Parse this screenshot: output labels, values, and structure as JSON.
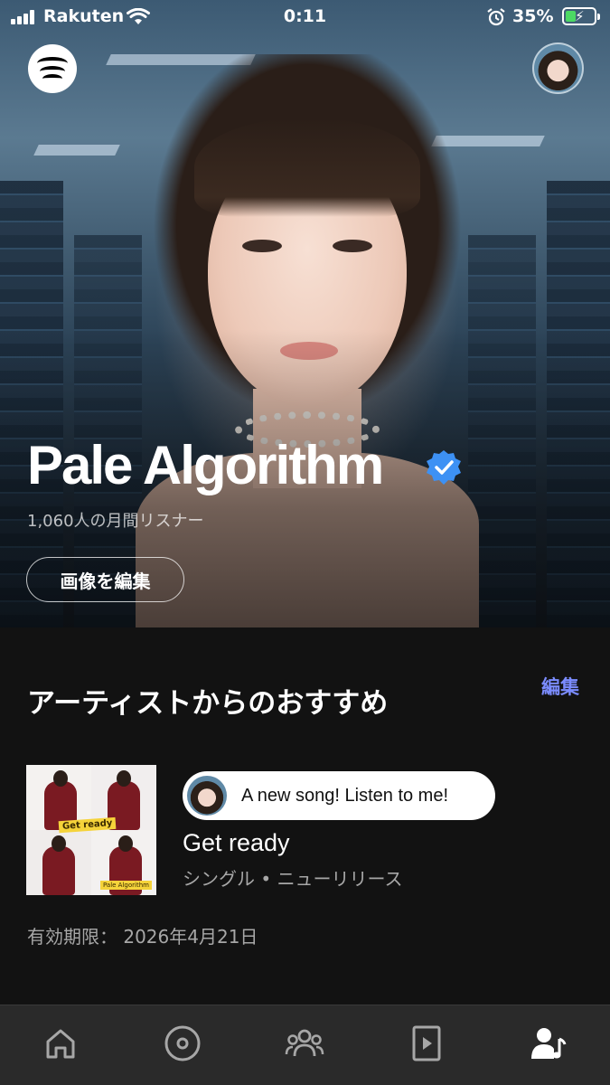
{
  "status_bar": {
    "carrier": "Rakuten",
    "time": "0:11",
    "battery": "35%"
  },
  "artist": {
    "name": "Pale Algorithm",
    "monthly_listeners": "1,060人の月間リスナー",
    "edit_image_label": "画像を編集"
  },
  "recommendation": {
    "section_title": "アーティストからのおすすめ",
    "edit_label": "編集",
    "message": "A new song! Listen to me!",
    "release_title": "Get ready",
    "release_subtitle": "シングル • ニューリリース",
    "expiry": "有効期限： 2026年4月21日",
    "cover_text": "Get ready",
    "cover_subtext": "Pale Algorithm"
  },
  "tabbar": {
    "items": [
      {
        "icon": "home-icon"
      },
      {
        "icon": "disc-icon"
      },
      {
        "icon": "audience-icon"
      },
      {
        "icon": "video-icon"
      },
      {
        "icon": "artist-profile-icon",
        "active": true
      }
    ]
  },
  "colors": {
    "background": "#121212",
    "accent_link": "#7b8cff",
    "verified": "#3d91f4",
    "tabbar": "#2a2a2a",
    "battery": "#4cd964"
  }
}
